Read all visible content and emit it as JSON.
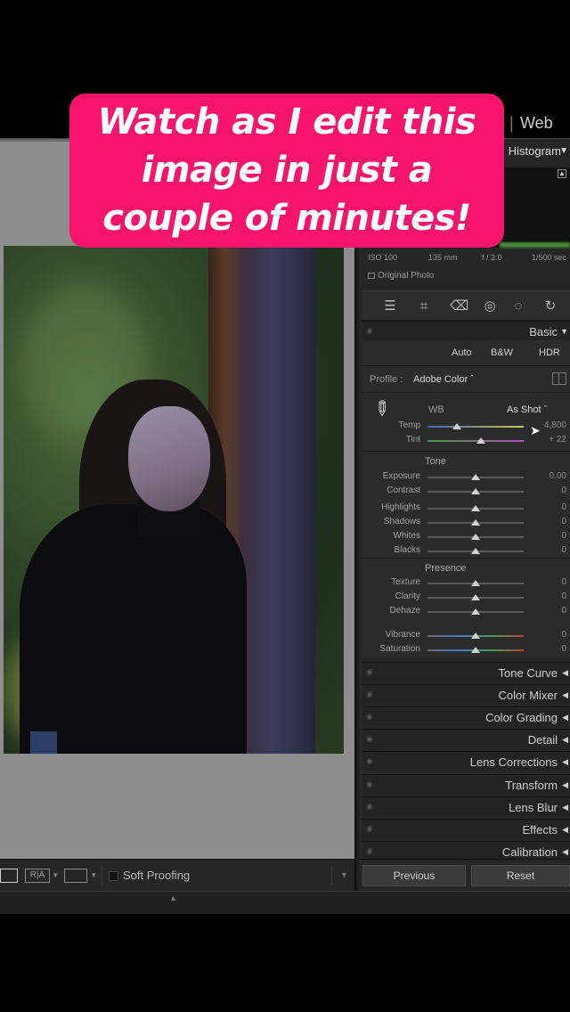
{
  "top": {
    "module_web": "Web",
    "module_sep": "|"
  },
  "caption": "Watch as I edit this\nimage in just a\ncouple of minutes!",
  "histogram": {
    "title": "Histogram",
    "exif": [
      "ISO 100",
      "135 mm",
      "f / 2.0",
      "1/500 sec"
    ],
    "original_photo": "Original Photo"
  },
  "basic": {
    "title": "Basic",
    "treatments": [
      "Auto",
      "B&W",
      "HDR"
    ],
    "profile_label": "Profile :",
    "profile_value": "Adobe Color ˆ",
    "wb_label": "WB",
    "wb_value": "As Shot ˆ",
    "tone_label": "Tone",
    "presence_label": "Presence",
    "sliders": {
      "temp": {
        "label": "Temp",
        "value": "4,800",
        "pos": 0.31
      },
      "tint": {
        "label": "Tint",
        "value": "+ 22",
        "pos": 0.56
      },
      "exposure": {
        "label": "Exposure",
        "value": "0.00",
        "pos": 0.5
      },
      "contrast": {
        "label": "Contrast",
        "value": "0",
        "pos": 0.5
      },
      "highlights": {
        "label": "Highlights",
        "value": "0",
        "pos": 0.5
      },
      "shadows": {
        "label": "Shadows",
        "value": "0",
        "pos": 0.5
      },
      "whites": {
        "label": "Whites",
        "value": "0",
        "pos": 0.5
      },
      "blacks": {
        "label": "Blacks",
        "value": "0",
        "pos": 0.5
      },
      "texture": {
        "label": "Texture",
        "value": "0",
        "pos": 0.5
      },
      "clarity": {
        "label": "Clarity",
        "value": "0",
        "pos": 0.5
      },
      "dehaze": {
        "label": "Dehaze",
        "value": "0",
        "pos": 0.5
      },
      "vibrance": {
        "label": "Vibrance",
        "value": "0",
        "pos": 0.5
      },
      "saturation": {
        "label": "Saturation",
        "value": "0",
        "pos": 0.5
      }
    }
  },
  "sections": [
    "Tone Curve",
    "Color Mixer",
    "Color Grading",
    "Detail",
    "Lens Corrections",
    "Transform",
    "Lens Blur",
    "Effects",
    "Calibration"
  ],
  "toolbar": {
    "soft_proofing": "Soft Proofing",
    "compare": "R|A"
  },
  "buttons": {
    "previous": "Previous",
    "reset": "Reset"
  },
  "colors": {
    "caption_bg": "#f7146c",
    "panel_bg": "#262626",
    "viewer_bg": "#8e8e8e"
  }
}
